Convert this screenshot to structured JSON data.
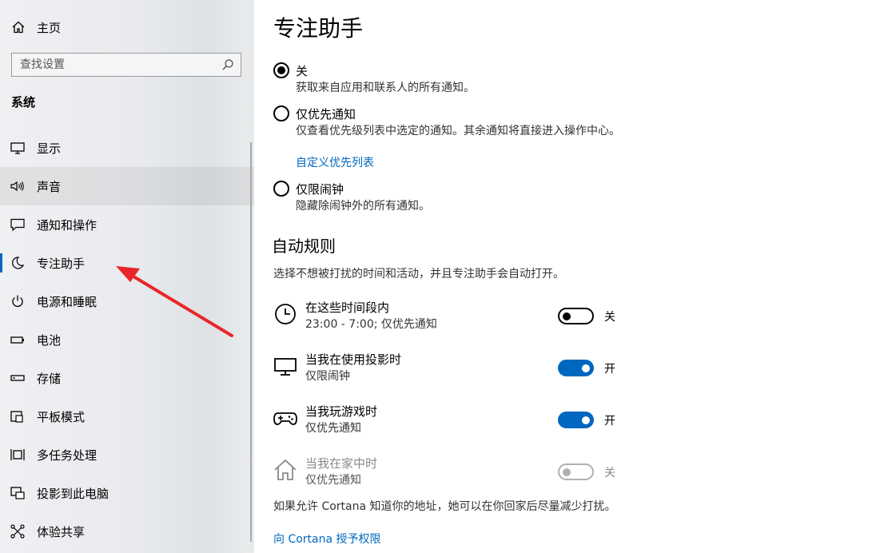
{
  "sidebar": {
    "home_label": "主页",
    "search_placeholder": "查找设置",
    "section_title": "系统",
    "items": [
      {
        "label": "显示",
        "icon": "monitor-icon"
      },
      {
        "label": "声音",
        "icon": "speaker-icon"
      },
      {
        "label": "通知和操作",
        "icon": "notification-icon"
      },
      {
        "label": "专注助手",
        "icon": "moon-icon",
        "selected": true
      },
      {
        "label": "电源和睡眠",
        "icon": "power-icon"
      },
      {
        "label": "电池",
        "icon": "battery-icon"
      },
      {
        "label": "存储",
        "icon": "storage-icon"
      },
      {
        "label": "平板模式",
        "icon": "tablet-icon"
      },
      {
        "label": "多任务处理",
        "icon": "multitask-icon"
      },
      {
        "label": "投影到此电脑",
        "icon": "project-icon"
      },
      {
        "label": "体验共享",
        "icon": "share-icon"
      }
    ]
  },
  "main": {
    "title": "专注助手",
    "options": [
      {
        "label": "关",
        "desc": "获取来自应用和联系人的所有通知。",
        "checked": true
      },
      {
        "label": "仅优先通知",
        "desc": "仅查看优先级列表中选定的通知。其余通知将直接进入操作中心。",
        "link": "自定义优先列表",
        "checked": false
      },
      {
        "label": "仅限闹钟",
        "desc": "隐藏除闹钟外的所有通知。",
        "checked": false
      }
    ],
    "auto_rules_title": "自动规则",
    "auto_rules_desc": "选择不想被打扰的时间和活动，并且专注助手会自动打开。",
    "rules": [
      {
        "name": "在这些时间段内",
        "sub": "23:00 - 7:00; 仅优先通知",
        "icon": "clock-icon",
        "state": "关",
        "on": false,
        "enabled": true
      },
      {
        "name": "当我在使用投影时",
        "sub": "仅限闹钟",
        "icon": "monitor-icon",
        "state": "开",
        "on": true,
        "enabled": true
      },
      {
        "name": "当我玩游戏时",
        "sub": "仅优先通知",
        "icon": "gamepad-icon",
        "state": "开",
        "on": true,
        "enabled": true
      },
      {
        "name": "当我在家中时",
        "sub": "仅优先通知",
        "icon": "home-icon",
        "state": "关",
        "on": false,
        "enabled": false
      }
    ],
    "footer_text": "如果允许 Cortana 知道你的地址，她可以在你回家后尽量减少打扰。",
    "footer_link": "向 Cortana 授予权限"
  },
  "colors": {
    "accent": "#0067c0",
    "annotation_arrow": "#e8262a"
  }
}
